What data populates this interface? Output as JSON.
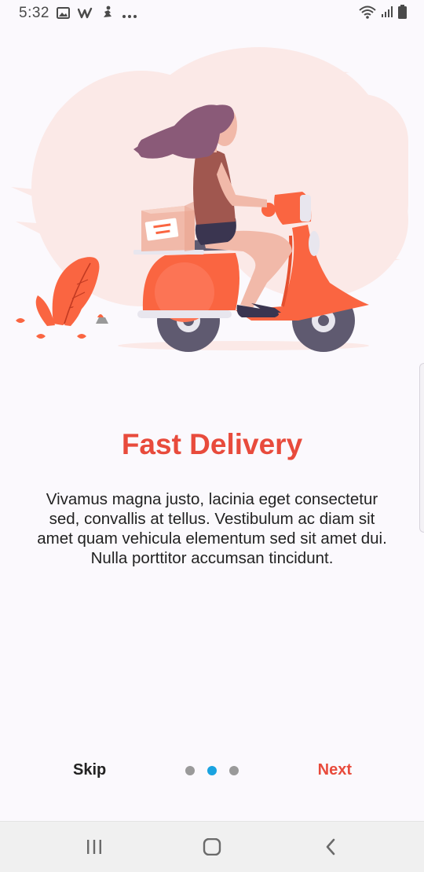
{
  "status_bar": {
    "time": "5:32",
    "left_icons": [
      "image-icon",
      "w-app-icon",
      "yoga-app-icon",
      "more-dots-icon"
    ],
    "right_icons": [
      "wifi-icon",
      "signal-icon",
      "battery-icon"
    ]
  },
  "onboarding": {
    "title": "Fast Delivery",
    "description": "Vivamus magna justo, lacinia eget consectetur sed, convallis at tellus. Vestibulum ac diam sit amet quam vehicula elementum sed sit amet dui. Nulla porttitor accumsan tincidunt.",
    "skip_label": "Skip",
    "next_label": "Next",
    "pages": 3,
    "active_page": 2
  },
  "colors": {
    "accent": "#e84b3c",
    "dot_active": "#1aa3e0",
    "dot_inactive": "#9a9a9a",
    "scooter": "#fa6541"
  },
  "nav_bar": {
    "buttons": [
      "recent-apps-icon",
      "home-icon",
      "back-icon"
    ]
  }
}
